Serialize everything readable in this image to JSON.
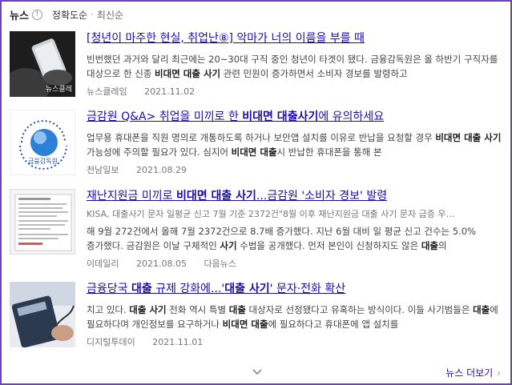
{
  "header": {
    "title": "뉴스",
    "info_icon": "!",
    "sort_active": "정확도순",
    "sort_separator": "·",
    "sort_other": "최신순"
  },
  "items": [
    {
      "title": "[청년이 마주한 현실, 취업난⑧] 악마가 너의 이름을 부를 때",
      "snippet_parts": [
        {
          "text": "빈번했던 과거와 달리 최근에는 20~30대 구직 중인 청년이 타겟이 됐다. 금융감독원은 올 하반기 구직자를 대상으로 한 신종 "
        },
        {
          "text": "비대면 대출 사기",
          "bold": true
        },
        {
          "text": " 관련 민원이 증가하면서 소비자 경보를 발령하고"
        }
      ],
      "source": "뉴스클레임",
      "date": "2021.11.02",
      "thumb_icon": "phone-in-hand-photo",
      "thumb_caption": "뉴스클레"
    },
    {
      "title": "금감원 Q&A> 취업을 미끼로 한 비대면 대출사기에 유의하세요",
      "title_parts": [
        {
          "text": "금감원 Q&A> 취업을 미끼로 한 "
        },
        {
          "text": "비대면 대출사기",
          "bold": true
        },
        {
          "text": "에 유의하세요"
        }
      ],
      "snippet_parts": [
        {
          "text": "업무용 휴대폰을 직원 명의로 개통하도록 하거나 보안앱 설치를 이유로 반납을 요청할 경우 "
        },
        {
          "text": "비대면 대출 사기",
          "bold": true
        },
        {
          "text": " 가능성에 주의할 필요가 있다. 심지어 "
        },
        {
          "text": "비대면 대출",
          "bold": true
        },
        {
          "text": "시 반납한 휴대폰을 통해 본"
        }
      ],
      "source": "전남일보",
      "date": "2021.08.29",
      "thumb_icon": "fss-logo",
      "thumb_caption": "금융감독원"
    },
    {
      "title_parts": [
        {
          "text": "재난지원금 미끼로 "
        },
        {
          "text": "비대면 대출 사기",
          "bold": true
        },
        {
          "text": "...금감원 '소비자 경보' 발령"
        }
      ],
      "extra": "KISA, 대출사기 문자 일평균 신고 7월 기준 2372건\"8월 이후 재난지원금 대출 사기 문자 급증 우…",
      "snippet_parts": [
        {
          "text": "해 9월 272건에서 올해 7월 2372건으로 8.7배 증가했다. 지난 6월 대비 일 평균 신고 건수는 5.0% 증가했다. 금감원은 이날 구체적인 "
        },
        {
          "text": "사기",
          "bold": true
        },
        {
          "text": " 수법을 공개했다. 먼저 본인이 신청하지도 않은 "
        },
        {
          "text": "대출",
          "bold": true
        },
        {
          "text": "의"
        }
      ],
      "source": "이데일리",
      "date": "2021.08.05",
      "related": "다음뉴스",
      "thumb_icon": "document-photo"
    },
    {
      "title_parts": [
        {
          "text": "금융당국 "
        },
        {
          "text": "대출",
          "bold": true
        },
        {
          "text": " 규제 강화에...'"
        },
        {
          "text": "대출 사기",
          "bold": true
        },
        {
          "text": "' 문자·전화 확산"
        }
      ],
      "snippet_parts": [
        {
          "text": "치고 있다. "
        },
        {
          "text": "대출 사기",
          "bold": true
        },
        {
          "text": " 전화 역시 특별 "
        },
        {
          "text": "대출",
          "bold": true
        },
        {
          "text": " 대상자로 선정됐다고 유혹하는 방식이다. 이들 사기범들은 "
        },
        {
          "text": "대출",
          "bold": true
        },
        {
          "text": "에 필요하다며 개인정보를 요구하거나 "
        },
        {
          "text": "비대면 대출",
          "bold": true
        },
        {
          "text": "에 필요하다고 휴대폰에 앱 설치를"
        }
      ],
      "source": "디지털투데이",
      "date": "2021.11.01",
      "thumb_icon": "calculator-photo"
    }
  ],
  "footer": {
    "expand_icon": "chevron-down-icon",
    "more_label": "뉴스 더보기",
    "more_icon": "chevron-right-icon"
  },
  "colors": {
    "frame": "#6a43b8",
    "link": "#1a0dab"
  }
}
